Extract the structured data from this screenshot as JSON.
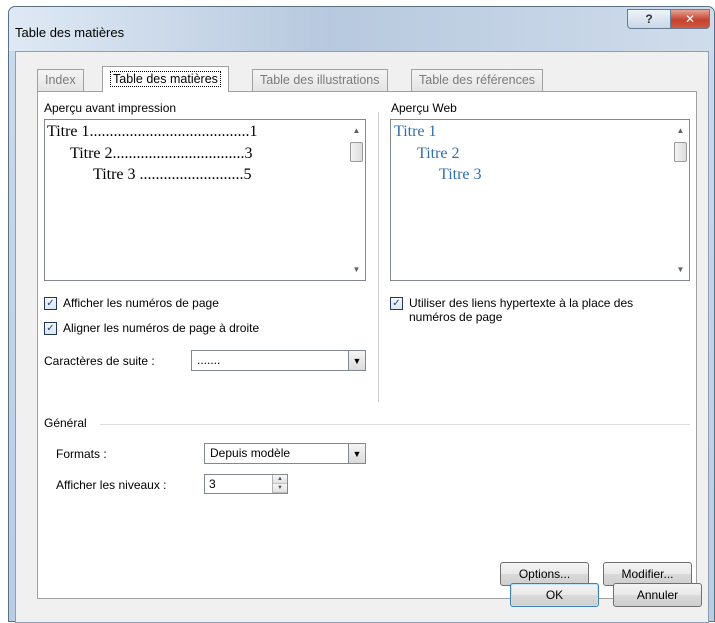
{
  "window": {
    "title": "Table des matières",
    "help_label": "?",
    "close_label": "✕"
  },
  "tabs": [
    {
      "label": "Index",
      "active": false
    },
    {
      "label": "Table des matières",
      "active": true
    },
    {
      "label": "Table des illustrations",
      "active": false
    },
    {
      "label": "Table des références",
      "active": false
    }
  ],
  "print_preview": {
    "label": "Aperçu avant impression",
    "lines": [
      {
        "text": "Titre 1........................................1"
      },
      {
        "text": "Titre 2.................................3"
      },
      {
        "text": "Titre 3 ..........................5"
      }
    ]
  },
  "web_preview": {
    "label": "Aperçu Web",
    "lines": [
      "Titre 1",
      "Titre 2",
      "Titre 3"
    ],
    "link_color": "#2f6fae"
  },
  "options": {
    "show_page_numbers": {
      "label": "Afficher les numéros de page",
      "checked": true
    },
    "align_right": {
      "label": "Aligner les numéros de page à droite",
      "checked": true
    },
    "hyperlinks": {
      "label_line1": "Utiliser des liens hypertexte à la place des",
      "label_line2": "numéros de page",
      "checked": true
    },
    "tab_leader": {
      "label": "Caractères de suite :",
      "value": "......."
    }
  },
  "general": {
    "label": "Général",
    "formats": {
      "label": "Formats :",
      "value": "Depuis modèle"
    },
    "levels": {
      "label": "Afficher les niveaux :",
      "value": "3"
    }
  },
  "buttons": {
    "options": "Options...",
    "modify": "Modifier...",
    "ok": "OK",
    "cancel": "Annuler"
  }
}
